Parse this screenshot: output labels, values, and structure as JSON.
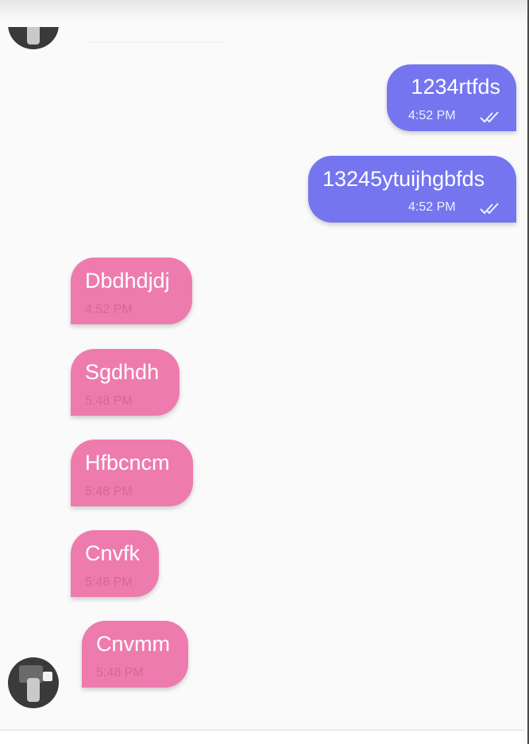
{
  "colors": {
    "outgoing_bubble": "#7475ef",
    "incoming_bubble": "#ee7bae",
    "background": "#fafafa"
  },
  "messages": [
    {
      "direction": "outgoing",
      "text": "1234rtfds",
      "time": "4:52 PM",
      "status_icon": "double-check-icon"
    },
    {
      "direction": "outgoing",
      "text": "13245ytuijhgbfds",
      "time": "4:52 PM",
      "status_icon": "double-check-icon"
    },
    {
      "direction": "incoming",
      "text": "Dbdhdjdj",
      "time": "4:52 PM"
    },
    {
      "direction": "incoming",
      "text": "Sgdhdh",
      "time": "5:48 PM"
    },
    {
      "direction": "incoming",
      "text": "Hfbcncm",
      "time": "5:48 PM"
    },
    {
      "direction": "incoming",
      "text": "Cnvfk",
      "time": "5:48 PM"
    },
    {
      "direction": "incoming",
      "text": "Cnvmm",
      "time": "5:48 PM"
    }
  ]
}
